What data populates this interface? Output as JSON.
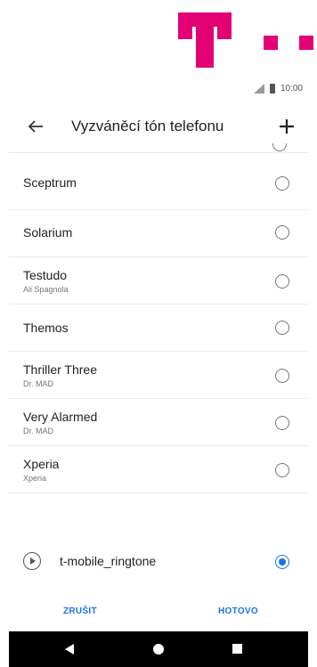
{
  "brand": {
    "name": "T-Mobile",
    "color": "#e20074"
  },
  "status_bar": {
    "time": "10:00",
    "icons": [
      "signal-icon",
      "battery-icon"
    ]
  },
  "app_bar": {
    "title": "Vyzváněcí tón telefonu",
    "back_icon": "back-arrow-icon",
    "add_icon": "plus-icon"
  },
  "ringtones": [
    {
      "name": "Sceptrum",
      "subtitle": "",
      "selected": false
    },
    {
      "name": "Solarium",
      "subtitle": "",
      "selected": false
    },
    {
      "name": "Testudo",
      "subtitle": "Ali Spagnola",
      "selected": false
    },
    {
      "name": "Themos",
      "subtitle": "",
      "selected": false
    },
    {
      "name": "Thriller Three",
      "subtitle": "Dr. MAD",
      "selected": false
    },
    {
      "name": "Very Alarmed",
      "subtitle": "Dr. MAD",
      "selected": false
    },
    {
      "name": "Xperia",
      "subtitle": "Xperia",
      "selected": false
    }
  ],
  "custom_ringtone": {
    "name": "t-mobile_ringtone",
    "selected": true
  },
  "actions": {
    "cancel_label": "ZRUŠIT",
    "done_label": "HOTOVO"
  },
  "accent_color": "#1a73e8"
}
